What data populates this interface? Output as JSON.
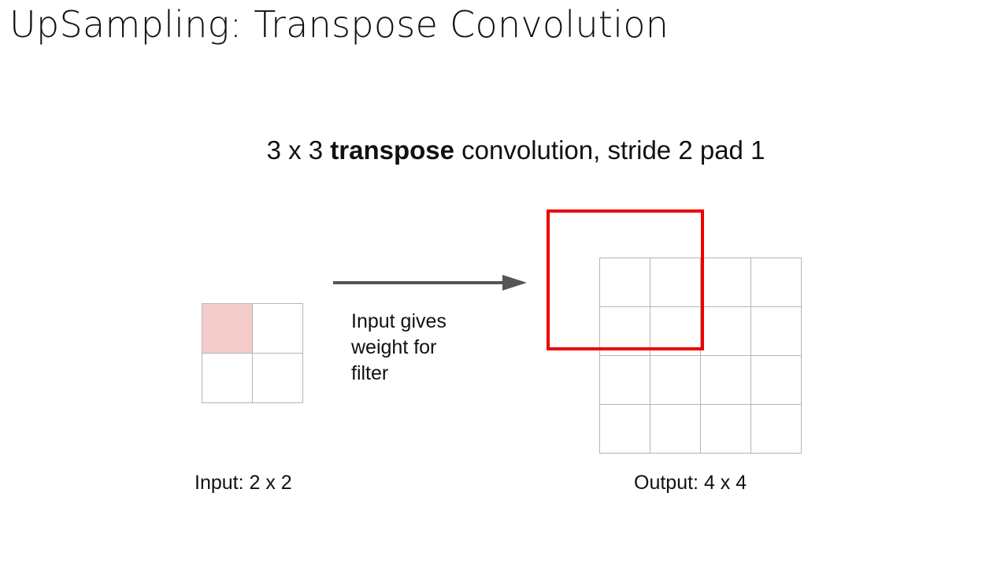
{
  "slide": {
    "title": "UpSampling: Transpose Convolution"
  },
  "diagram": {
    "subtitle_prefix": "3 x 3 ",
    "subtitle_bold": "transpose",
    "subtitle_suffix": " convolution, stride 2 pad 1",
    "arrow_text_lines": [
      "Input gives",
      "weight for",
      "filter"
    ],
    "input_label": "Input: 2 x 2",
    "output_label": "Output: 4 x 4",
    "input_grid": {
      "rows": 2,
      "cols": 2,
      "highlighted_cell": [
        0,
        0
      ]
    },
    "output_grid": {
      "rows": 4,
      "cols": 4
    },
    "colors": {
      "highlight": "#f4cccc",
      "filter_box": "#ee0000",
      "arrow": "#555555",
      "grid_line": "#b5b5b5"
    }
  }
}
